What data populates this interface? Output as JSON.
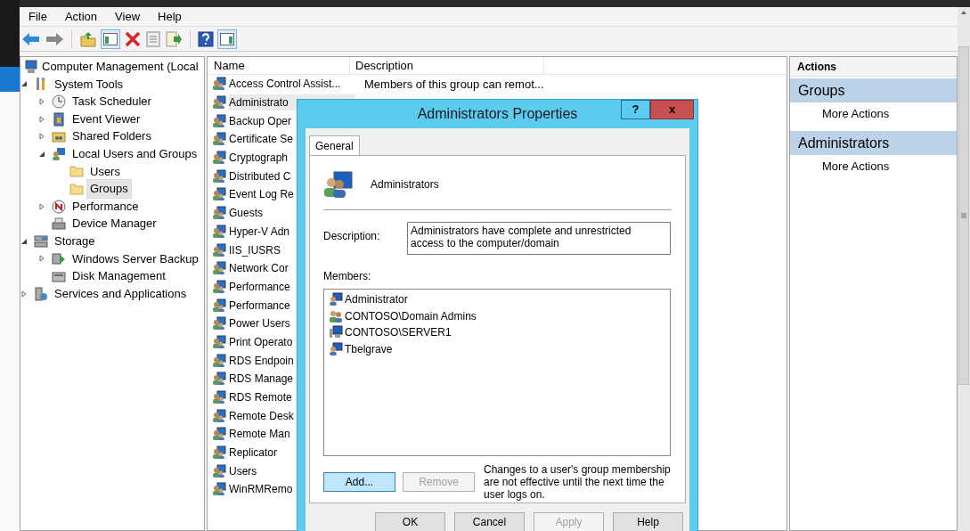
{
  "menu": [
    "File",
    "Action",
    "View",
    "Help"
  ],
  "toolbar": {
    "console_tree_on": true,
    "action_pane_on": true
  },
  "tree": {
    "label": "Computer Management (Local",
    "kind": "computer",
    "children": [
      {
        "label": "System Tools",
        "kind": "tools",
        "expanded": true,
        "children": [
          {
            "label": "Task Scheduler",
            "kind": "clock",
            "expanded": false
          },
          {
            "label": "Event Viewer",
            "kind": "event",
            "expanded": false
          },
          {
            "label": "Shared Folders",
            "kind": "share",
            "expanded": false
          },
          {
            "label": "Local Users and Groups",
            "kind": "users",
            "expanded": true,
            "children": [
              {
                "label": "Users",
                "kind": "folder",
                "selected": false
              },
              {
                "label": "Groups",
                "kind": "folder",
                "selected": true
              }
            ]
          },
          {
            "label": "Performance",
            "kind": "perf",
            "expanded": false
          },
          {
            "label": "Device Manager",
            "kind": "device"
          }
        ]
      },
      {
        "label": "Storage",
        "kind": "storage",
        "expanded": true,
        "children": [
          {
            "label": "Windows Server Backup",
            "kind": "backup",
            "expanded": false
          },
          {
            "label": "Disk Management",
            "kind": "disk"
          }
        ]
      },
      {
        "label": "Services and Applications",
        "kind": "services",
        "expanded": false
      }
    ]
  },
  "list": {
    "columns": [
      "Name",
      "Description"
    ],
    "rows": [
      {
        "name": "Access Control Assist...",
        "description": "Members of this group can remot...",
        "selected": false
      },
      {
        "name": "Administrato",
        "selected": true
      },
      {
        "name": "Backup Oper",
        "selected": false
      },
      {
        "name": "Certificate Se",
        "selected": false
      },
      {
        "name": "Cryptograph",
        "selected": false
      },
      {
        "name": "Distributed C",
        "selected": false
      },
      {
        "name": "Event Log Re",
        "selected": false
      },
      {
        "name": "Guests",
        "selected": false
      },
      {
        "name": "Hyper-V Adn",
        "selected": false
      },
      {
        "name": "IIS_IUSRS",
        "selected": false
      },
      {
        "name": "Network Cor",
        "selected": false
      },
      {
        "name": "Performance",
        "selected": false
      },
      {
        "name": "Performance",
        "selected": false
      },
      {
        "name": "Power Users",
        "selected": false
      },
      {
        "name": "Print Operato",
        "selected": false
      },
      {
        "name": "RDS Endpoin",
        "selected": false
      },
      {
        "name": "RDS Manage",
        "selected": false
      },
      {
        "name": "RDS Remote",
        "selected": false
      },
      {
        "name": "Remote Desk",
        "selected": false
      },
      {
        "name": "Remote Man",
        "selected": false
      },
      {
        "name": "Replicator",
        "selected": false
      },
      {
        "name": "Users",
        "selected": false
      },
      {
        "name": "WinRMRemo",
        "selected": false
      }
    ]
  },
  "actions": {
    "title": "Actions",
    "sections": [
      {
        "title": "Groups",
        "items": [
          "More Actions"
        ]
      },
      {
        "title": "Administrators",
        "items": [
          "More Actions"
        ]
      }
    ]
  },
  "dialog": {
    "title": "Administrators Properties",
    "help": "?",
    "close": "x",
    "tabs": [
      {
        "label": "General",
        "selected": true
      }
    ],
    "group_name": "Administrators",
    "description_label": "Description:",
    "description": "Administrators have complete and unrestricted access to the computer/domain",
    "members_label": "Members:",
    "members": [
      {
        "name": "Administrator",
        "kind": "user"
      },
      {
        "name": "CONTOSO\\Domain Admins",
        "kind": "group"
      },
      {
        "name": "CONTOSO\\SERVER1",
        "kind": "computer"
      },
      {
        "name": "Tbelgrave",
        "kind": "user"
      }
    ],
    "member_buttons": [
      {
        "label": "Add...",
        "disabled": false,
        "highlighted": true
      },
      {
        "label": "Remove",
        "disabled": true,
        "highlighted": false
      }
    ],
    "note": "Changes to a user's group membership are not effective until the next time the user logs on.",
    "buttons": [
      {
        "label": "OK",
        "disabled": false,
        "highlighted": false
      },
      {
        "label": "Cancel",
        "disabled": false,
        "highlighted": false
      },
      {
        "label": "Apply",
        "disabled": true,
        "highlighted": false
      },
      {
        "label": "Help",
        "disabled": false,
        "highlighted": false
      }
    ]
  }
}
